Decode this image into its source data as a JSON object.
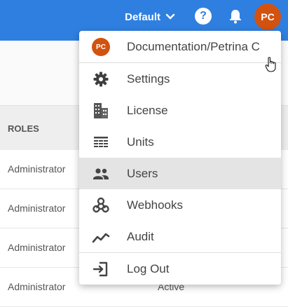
{
  "header": {
    "workspace": "Default",
    "avatar_initials": "PC"
  },
  "table": {
    "col_roles": "ROLES",
    "rows": [
      {
        "role": "Administrator",
        "status": ""
      },
      {
        "role": "Administrator",
        "status": ""
      },
      {
        "role": "Administrator",
        "status": ""
      },
      {
        "role": "Administrator",
        "status": "Active"
      }
    ]
  },
  "menu": {
    "items": [
      {
        "label": "Documentation/Petrina C",
        "icon": "avatar",
        "initials": "PC"
      },
      {
        "label": "Settings",
        "icon": "gear-icon"
      },
      {
        "label": "License",
        "icon": "building-icon"
      },
      {
        "label": "Units",
        "icon": "units-icon"
      },
      {
        "label": "Users",
        "icon": "users-icon",
        "active": true
      },
      {
        "label": "Webhooks",
        "icon": "webhooks-icon"
      },
      {
        "label": "Audit",
        "icon": "audit-icon"
      },
      {
        "label": "Log Out",
        "icon": "logout-icon"
      }
    ]
  }
}
